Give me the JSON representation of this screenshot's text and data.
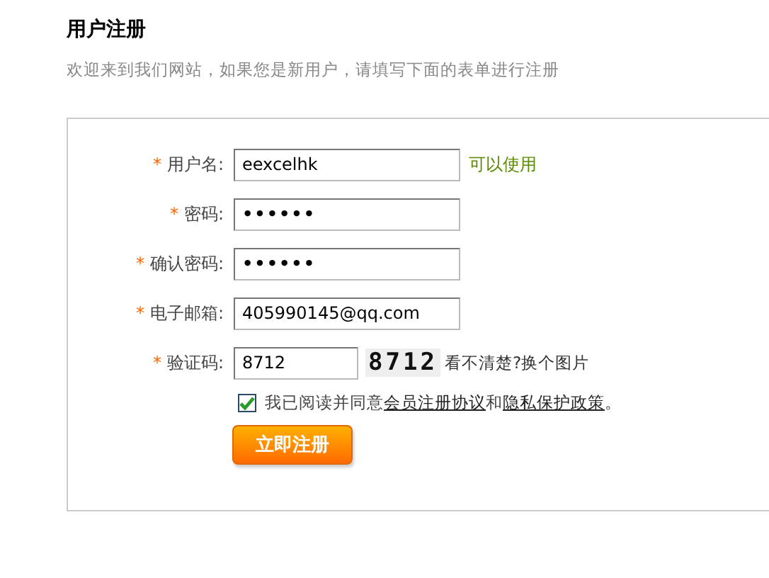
{
  "title": "用户注册",
  "subtitle": "欢迎来到我们网站，如果您是新用户，请填写下面的表单进行注册",
  "fields": [
    {
      "kind": "text",
      "required_mark": "*",
      "label": "用户名:",
      "value": "eexcelhk",
      "hint": "可以使用"
    },
    {
      "kind": "password",
      "required_mark": "*",
      "label": "密码:",
      "value": "••••••"
    },
    {
      "kind": "password",
      "required_mark": "*",
      "label": "确认密码:",
      "value": "••••••"
    },
    {
      "kind": "text",
      "required_mark": "*",
      "label": "电子邮箱:",
      "value": "405990145@qq.com"
    },
    {
      "kind": "captcha",
      "required_mark": "*",
      "label": "验证码:",
      "value": "8712",
      "captcha": "8712",
      "refresh_text": "看不清楚?换个图片"
    }
  ],
  "agreement": {
    "checked": true,
    "text": "我已阅读并同意",
    "link1": "会员注册协议",
    "joiner": "和",
    "link2": "隐私保护政策",
    "end": "。"
  },
  "submit": "立即注册"
}
